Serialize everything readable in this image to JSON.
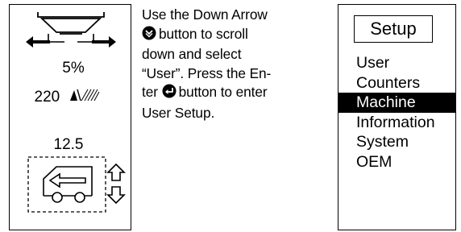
{
  "display": {
    "spread_percent": "5%",
    "application_rate": "220",
    "ground_speed": "12.5"
  },
  "instruction": {
    "line1": "Use the Down Arrow",
    "line2": "button to scroll",
    "line3": "down and select",
    "line4": "“User”. Press the En-",
    "line5_a": "ter",
    "line5_b": "button to enter",
    "line6": "User Setup."
  },
  "menu": {
    "title": "Setup",
    "items": [
      {
        "label": "User",
        "selected": false
      },
      {
        "label": "Counters",
        "selected": false
      },
      {
        "label": "Machine",
        "selected": true
      },
      {
        "label": "Information",
        "selected": false
      },
      {
        "label": "System",
        "selected": false
      },
      {
        "label": "OEM",
        "selected": false
      }
    ]
  },
  "icons": {
    "hopper": "hopper-icon",
    "spinner_left": "spinner-left-arrow-icon",
    "spinner_right": "spinner-right-arrow-icon",
    "rate_unit": "rate-per-area-icon",
    "truck": "truck-reverse-icon",
    "up": "up-arrow-icon",
    "down": "down-arrow-icon",
    "down_button": "down-arrow-button-icon",
    "enter_button": "enter-button-icon"
  }
}
